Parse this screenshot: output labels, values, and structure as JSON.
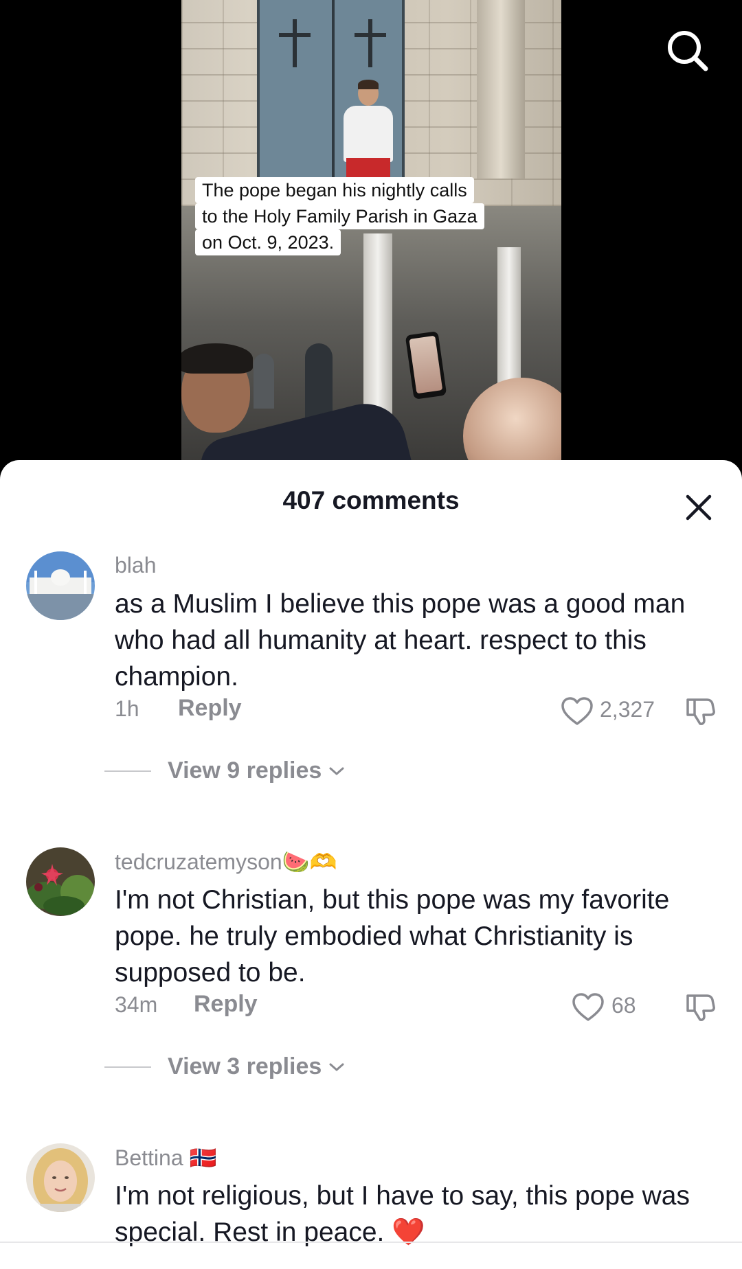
{
  "video": {
    "caption_lines": [
      "The pope began his nightly calls",
      "to the Holy Family Parish in Gaza",
      "on Oct. 9, 2023."
    ]
  },
  "sheet": {
    "title": "407 comments"
  },
  "comments": [
    {
      "username": "blah",
      "text": "as a Muslim I believe this pope was a good man who had all humanity at heart. respect to this champion.",
      "time": "1h",
      "reply_label": "Reply",
      "likes": "2,327",
      "view_replies": "View 9 replies"
    },
    {
      "username": "tedcruzatemyson🍉🫶",
      "text": "I'm not Christian, but this pope was my favorite pope. he truly embodied what Christianity is supposed to be.",
      "time": "34m",
      "reply_label": "Reply",
      "likes": "68",
      "view_replies": "View 3 replies"
    },
    {
      "username": "Bettina 🇳🇴",
      "text": "I'm not religious, but I have to say, this pope was special. Rest in peace. ❤️"
    }
  ],
  "colors": {
    "sheet_bg": "#ffffff",
    "text_primary": "#161823",
    "text_secondary": "#8a8b91",
    "heart_emoji": "#fe2c55"
  },
  "icons": [
    "search-icon",
    "close-icon",
    "heart-outline-icon",
    "dislike-icon",
    "chevron-down-icon"
  ]
}
